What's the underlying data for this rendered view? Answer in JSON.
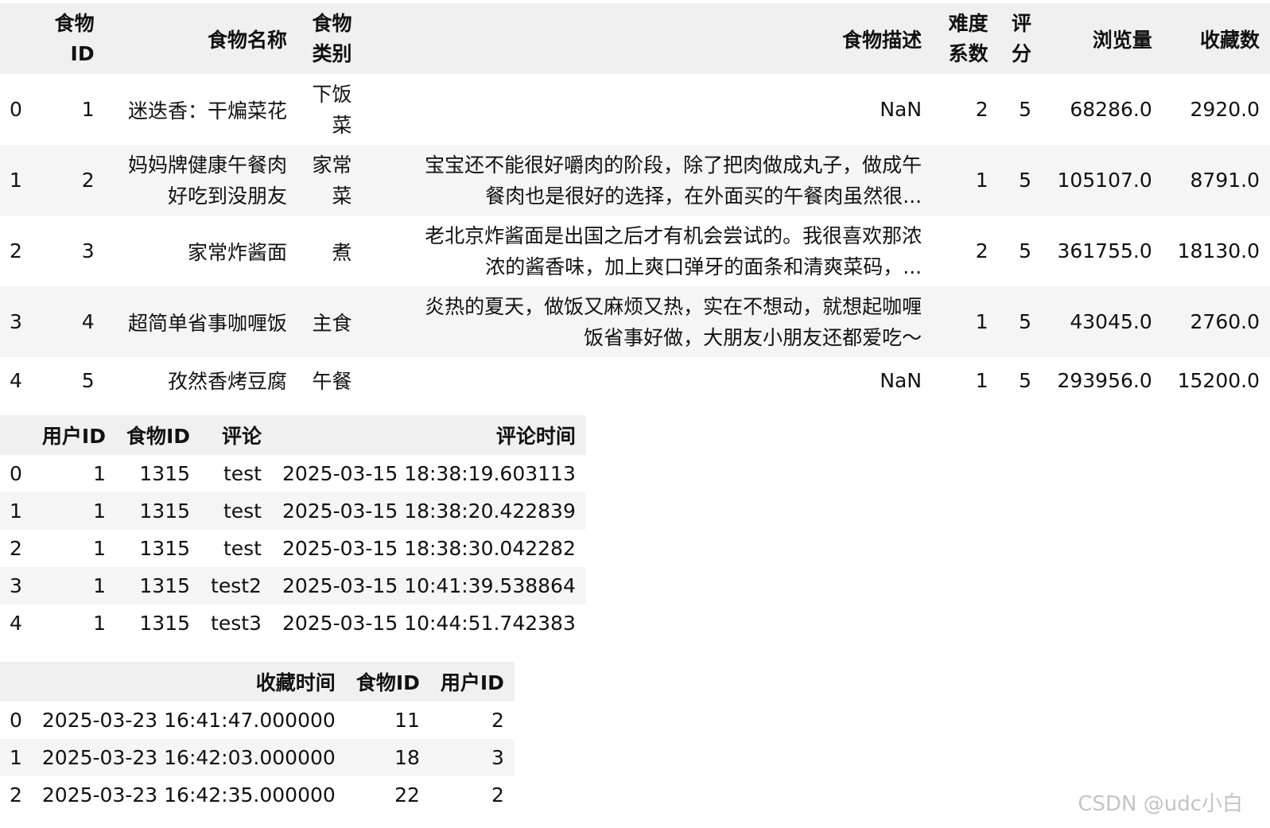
{
  "foods": {
    "headers": [
      "",
      "食物ID",
      "食物名称",
      "食物类别",
      "食物描述",
      "难度系数",
      "评分",
      "浏览量",
      "收藏数"
    ],
    "header_lines": {
      "id": [
        "食物",
        "ID"
      ],
      "category": [
        "食物",
        "类别"
      ],
      "difficulty": [
        "难度",
        "系数"
      ],
      "score": [
        "评",
        "分"
      ]
    },
    "rows": [
      {
        "idx": "0",
        "id": "1",
        "name": "迷迭香：干煸菜花",
        "category": [
          "下饭",
          "菜"
        ],
        "desc": "NaN",
        "difficulty": "2",
        "score": "5",
        "views": "68286.0",
        "favs": "2920.0"
      },
      {
        "idx": "1",
        "id": "2",
        "name": [
          "妈妈牌健康午餐肉",
          "好吃到没朋友"
        ],
        "category": [
          "家常",
          "菜"
        ],
        "desc": [
          "宝宝还不能很好嚼肉的阶段，除了把肉做成丸子，做成午",
          "餐肉也是很好的选择，在外面买的午餐肉虽然很..."
        ],
        "difficulty": "1",
        "score": "5",
        "views": "105107.0",
        "favs": "8791.0"
      },
      {
        "idx": "2",
        "id": "3",
        "name": "家常炸酱面",
        "category": "煮",
        "desc": [
          "老北京炸酱面是出国之后才有机会尝试的。我很喜欢那浓",
          "浓的酱香味，加上爽口弹牙的面条和清爽菜码，..."
        ],
        "difficulty": "2",
        "score": "5",
        "views": "361755.0",
        "favs": "18130.0"
      },
      {
        "idx": "3",
        "id": "4",
        "name": "超简单省事咖喱饭",
        "category": "主食",
        "desc": [
          "炎热的夏天，做饭又麻烦又热，实在不想动，就想起咖喱",
          "饭省事好做，大朋友小朋友还都爱吃～"
        ],
        "difficulty": "1",
        "score": "5",
        "views": "43045.0",
        "favs": "2760.0"
      },
      {
        "idx": "4",
        "id": "5",
        "name": "孜然香烤豆腐",
        "category": "午餐",
        "desc": "NaN",
        "difficulty": "1",
        "score": "5",
        "views": "293956.0",
        "favs": "15200.0"
      }
    ]
  },
  "comments": {
    "headers": [
      "",
      "用户ID",
      "食物ID",
      "评论",
      "评论时间"
    ],
    "rows": [
      {
        "idx": "0",
        "user_id": "1",
        "food_id": "1315",
        "comment": "test",
        "time": "2025-03-15 18:38:19.603113"
      },
      {
        "idx": "1",
        "user_id": "1",
        "food_id": "1315",
        "comment": "test",
        "time": "2025-03-15 18:38:20.422839"
      },
      {
        "idx": "2",
        "user_id": "1",
        "food_id": "1315",
        "comment": "test",
        "time": "2025-03-15 18:38:30.042282"
      },
      {
        "idx": "3",
        "user_id": "1",
        "food_id": "1315",
        "comment": "test2",
        "time": "2025-03-15 10:41:39.538864"
      },
      {
        "idx": "4",
        "user_id": "1",
        "food_id": "1315",
        "comment": "test3",
        "time": "2025-03-15 10:44:51.742383"
      }
    ]
  },
  "favorites": {
    "headers": [
      "",
      "收藏时间",
      "食物ID",
      "用户ID"
    ],
    "rows": [
      {
        "idx": "0",
        "time": "2025-03-23 16:41:47.000000",
        "food_id": "11",
        "user_id": "2"
      },
      {
        "idx": "1",
        "time": "2025-03-23 16:42:03.000000",
        "food_id": "18",
        "user_id": "3"
      },
      {
        "idx": "2",
        "time": "2025-03-23 16:42:35.000000",
        "food_id": "22",
        "user_id": "2"
      }
    ]
  },
  "watermark": "CSDN @udc小白",
  "colors": {
    "header_bg": "#f0f0f0",
    "stripe_bg": "#f5f5f5",
    "text": "#111111",
    "watermark": "#c4c4c4"
  }
}
